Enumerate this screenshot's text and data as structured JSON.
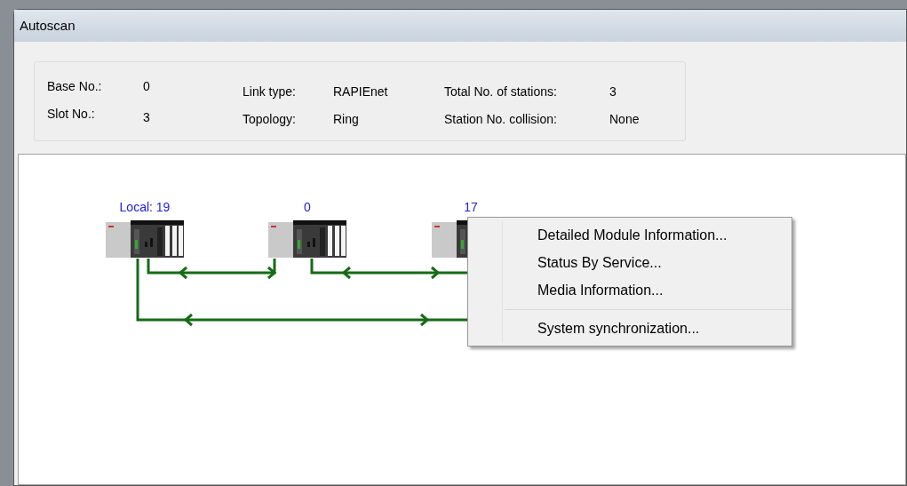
{
  "window": {
    "title": "Autoscan"
  },
  "info": [
    [
      {
        "label": "Base No.:",
        "value": "0"
      },
      {
        "label": "Slot No.:",
        "value": "3"
      }
    ],
    [
      {
        "label": "Link type:",
        "value": "RAPIEnet"
      },
      {
        "label": "Topology:",
        "value": "Ring"
      }
    ],
    [
      {
        "label": "Total No. of stations:",
        "value": "3"
      },
      {
        "label": "Station No. collision:",
        "value": "None"
      }
    ]
  ],
  "stations": [
    {
      "label": "Local: 19"
    },
    {
      "label": "0"
    },
    {
      "label": "17"
    }
  ],
  "context_menu": [
    {
      "kind": "item",
      "label": "Detailed Module Information..."
    },
    {
      "kind": "item",
      "label": "Status By Service..."
    },
    {
      "kind": "item",
      "label": "Media Information..."
    },
    {
      "kind": "separator"
    },
    {
      "kind": "item",
      "label": "System synchronization..."
    }
  ]
}
